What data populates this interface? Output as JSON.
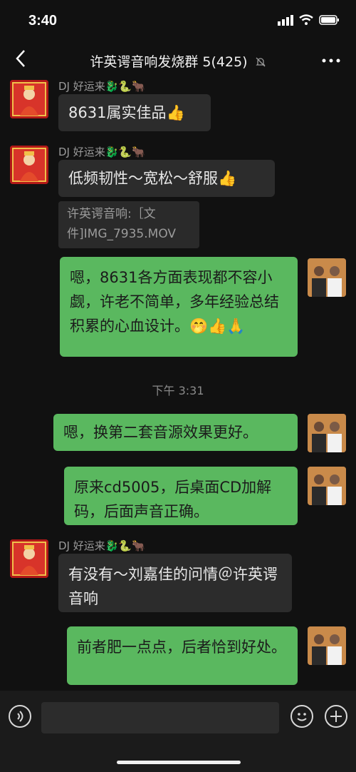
{
  "status_bar": {
    "time": "3:40"
  },
  "header": {
    "title": "许英谔音响发烧群 5(425)",
    "mute_icon": "bell-slash-icon",
    "more_icon": "ellipsis-icon"
  },
  "messages": [
    {
      "type": "incoming",
      "sender": "DJ 好运来🐉🐍🐂",
      "text": "8631属实佳品👍"
    },
    {
      "type": "incoming",
      "sender": "DJ 好运来🐉🐍🐂",
      "text": "低频韧性～宽松～舒服👍",
      "file": "许英谔音响:［文件]IMG_7935.MOV"
    },
    {
      "type": "outgoing",
      "text": "嗯，8631各方面表现都不容小觑，许老不简单，多年经验总结积累的心血设计。🤭👍🙏"
    },
    {
      "type": "timestamp",
      "text": "下午 3:31"
    },
    {
      "type": "outgoing",
      "text": "嗯，换第二套音源效果更好。"
    },
    {
      "type": "outgoing",
      "text": "原来cd5005，后桌面CD加解码，后面声音正确。"
    },
    {
      "type": "incoming",
      "sender": "DJ 好运来🐉🐍🐂",
      "text": "有没有～刘嘉佳的问情＠许英谔音响"
    },
    {
      "type": "outgoing",
      "text": "前者肥一点点，后者恰到好处。"
    }
  ],
  "input_bar": {
    "voice_icon": "voice-icon",
    "emoji_icon": "emoji-icon",
    "plus_icon": "plus-icon"
  }
}
